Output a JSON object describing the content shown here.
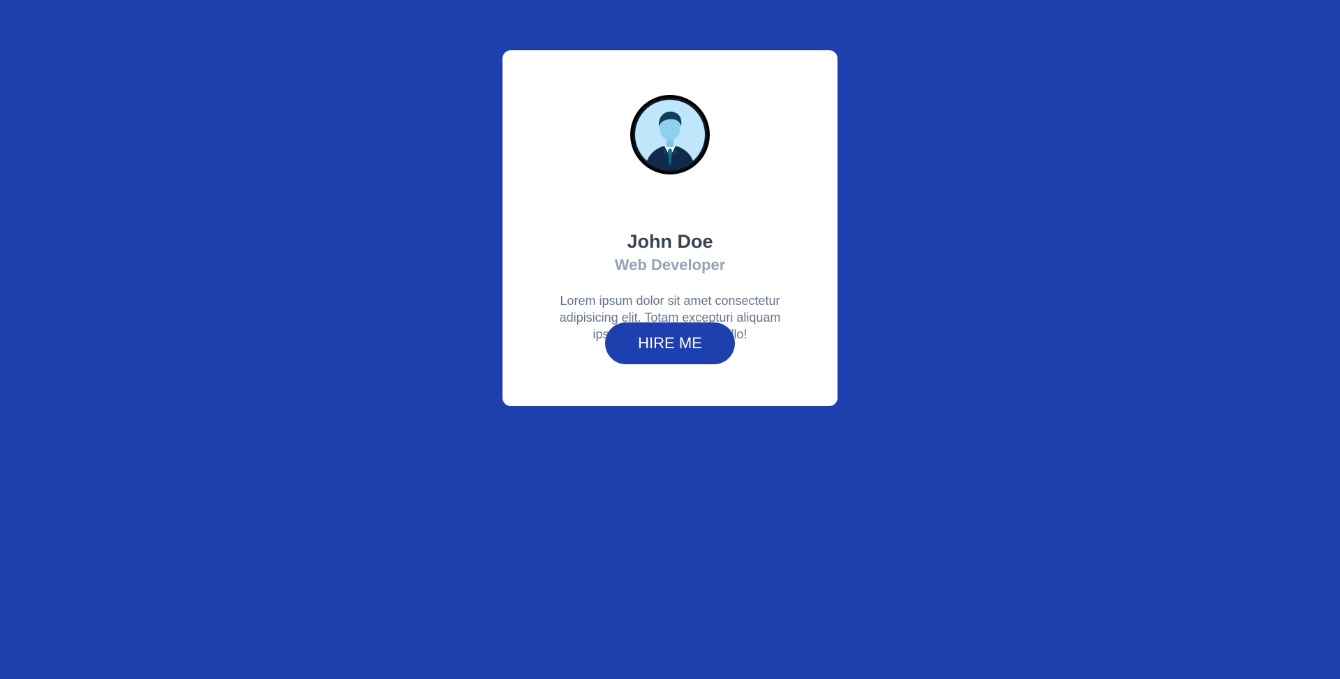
{
  "colors": {
    "background": "#1e40af",
    "card": "#ffffff",
    "button": "#1e40af",
    "name_text": "#374151",
    "role_text": "#94a3b8",
    "bio_text": "#64748b"
  },
  "profile": {
    "avatar_icon": "businessman-avatar-icon",
    "name": "John Doe",
    "role": "Web Developer",
    "bio": "Lorem ipsum dolor sit amet consectetur adipisicing elit. Totam excepturi aliquam ipsum voluptate minima illo!",
    "button_label": "HIRE ME"
  }
}
